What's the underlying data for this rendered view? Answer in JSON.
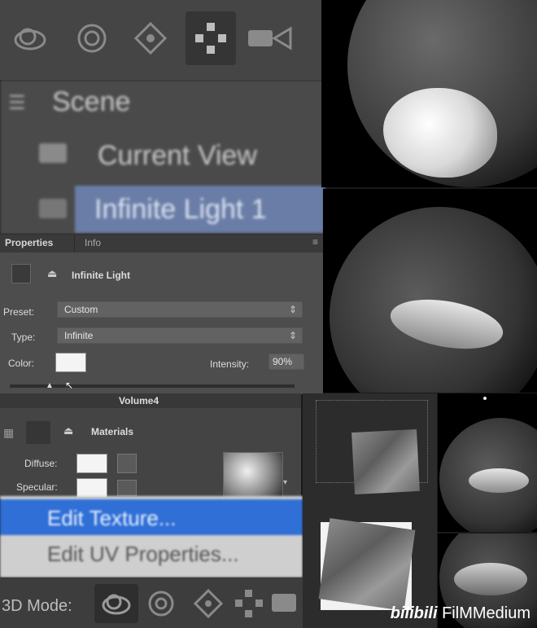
{
  "toolbar": {
    "icons": [
      "orbit-3d-icon",
      "roll-3d-icon",
      "drag-3d-icon",
      "slide-3d-icon",
      "scale-3d-icon"
    ]
  },
  "scene": {
    "root_label": "Scene",
    "items": [
      {
        "label": "Current View",
        "icon": "camera-icon"
      },
      {
        "label": "Infinite Light 1",
        "icon": "light-icon",
        "selected": true
      }
    ]
  },
  "properties": {
    "tabs": [
      "Properties",
      "Info"
    ],
    "header_title": "Infinite Light",
    "preset_label": "Preset:",
    "preset_value": "Custom",
    "type_label": "Type:",
    "type_value": "Infinite",
    "color_label": "Color:",
    "color_value": "#f4f4f4",
    "intensity_label": "Intensity:",
    "intensity_value": "90%"
  },
  "volume": {
    "title": "Volume4",
    "section": "Materials",
    "diffuse_label": "Diffuse:",
    "specular_label": "Specular:"
  },
  "context_menu": {
    "items": [
      "Edit Texture...",
      "Edit UV Properties..."
    ]
  },
  "mode_bar": {
    "label": "3D Mode:"
  },
  "watermark": {
    "text": "FilMMedium",
    "brand": "bilibili"
  },
  "colors": {
    "selection": "#6a7da6",
    "menu_highlight": "#2f6fd6"
  }
}
